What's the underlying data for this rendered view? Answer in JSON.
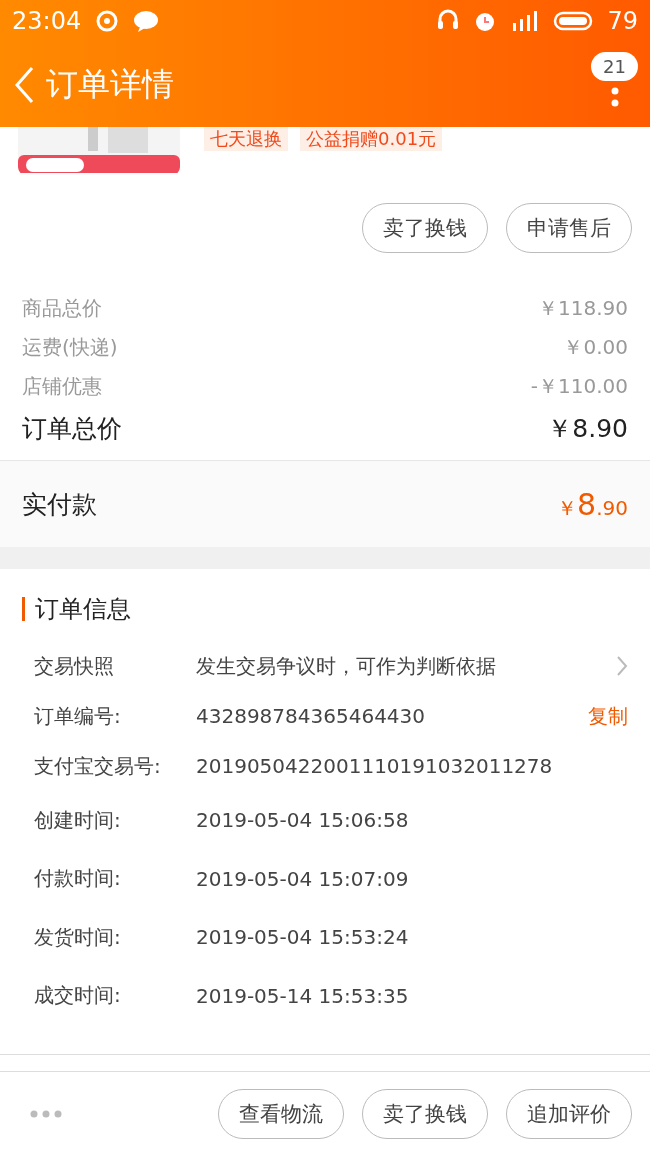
{
  "status_bar": {
    "time": "23:04",
    "battery": "79"
  },
  "header": {
    "title": "订单详情",
    "badge": "21"
  },
  "product": {
    "tags": [
      "七天退换",
      "公益捐赠0.01元"
    ]
  },
  "actions": [
    "卖了换钱",
    "申请售后"
  ],
  "prices": [
    {
      "label": "商品总价",
      "value": "￥118.90",
      "kind": "line"
    },
    {
      "label": "运费(快递)",
      "value": "￥0.00",
      "kind": "line"
    },
    {
      "label": "店铺优惠",
      "value": "-￥110.00",
      "kind": "line"
    },
    {
      "label": "订单总价",
      "value": "￥8.90",
      "kind": "total"
    }
  ],
  "paid": {
    "label": "实付款",
    "currency": "￥",
    "integer": "8",
    "decimal": ".90"
  },
  "order_info": {
    "title": "订单信息",
    "rows": [
      {
        "label": "交易快照",
        "value": "发生交易争议时，可作为判断依据",
        "kind": "link"
      },
      {
        "label": "订单编号:",
        "value": "432898784365464430",
        "kind": "copy",
        "action": "复制"
      },
      {
        "label": "支付宝交易号:",
        "value": "2019050422001110191032011278",
        "kind": "plain"
      },
      {
        "label": "创建时间:",
        "value": "2019-05-04 15:06:58",
        "kind": "plain"
      },
      {
        "label": "付款时间:",
        "value": "2019-05-04 15:07:09",
        "kind": "plain"
      },
      {
        "label": "发货时间:",
        "value": "2019-05-04 15:53:24",
        "kind": "plain"
      },
      {
        "label": "成交时间:",
        "value": "2019-05-14 15:53:35",
        "kind": "plain"
      }
    ]
  },
  "bottom_buttons": [
    "查看物流",
    "卖了换钱",
    "追加评价"
  ]
}
